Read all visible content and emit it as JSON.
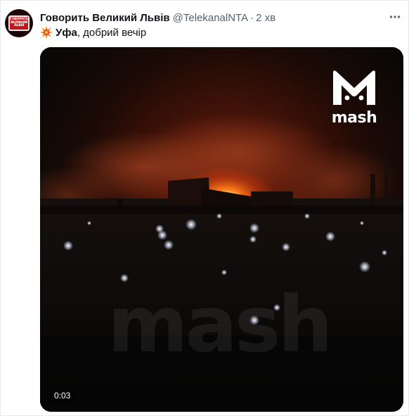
{
  "tweet": {
    "display_name": "Говорить Великий Львів",
    "handle": "@TelekanalNTA",
    "separator": "·",
    "time": "2 хв",
    "avatar_icon": "channel-logo-avatar",
    "avatar_logo_lines": [
      "ГОВОРИТЬ",
      "ВЕЛИКИЙ",
      "ЛЬВІВ"
    ],
    "more_icon": "ellipsis-icon",
    "text_emoji_icon": "collision-emoji-icon",
    "text_bold": "Уфа",
    "text_rest": ", добрий вечір"
  },
  "media": {
    "type": "video",
    "duration": "0:03",
    "brand_icon": "mash-cat-logo-icon",
    "brand_word": "mash",
    "watermark": "mash",
    "description_icon": "night-fire-scene"
  },
  "colors": {
    "text_primary": "#0f1419",
    "text_secondary": "#536471",
    "fire": "#ff7a1a"
  }
}
